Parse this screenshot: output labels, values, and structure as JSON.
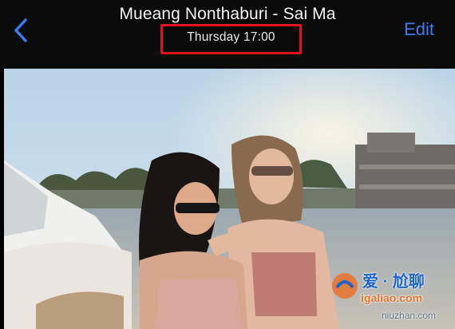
{
  "header": {
    "title": "Mueang Nonthaburi - Sai Ma",
    "subtitle": "Thursday  17:00",
    "edit_label": "Edit",
    "back_icon": "chevron-left-icon",
    "accent_color": "#3d7cf0",
    "highlight_color": "#e0141c"
  },
  "photo": {
    "watermark": {
      "line1": "爱 · 尬聊",
      "line2": "igaliao.com",
      "line3": "niuzhan.com"
    }
  }
}
